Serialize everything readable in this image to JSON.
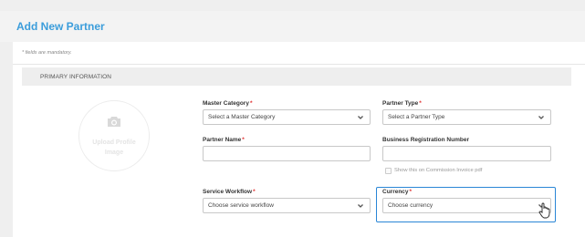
{
  "header": {
    "title": "Add New Partner"
  },
  "form": {
    "mandatory_note": "* fields are mandatory.",
    "section_title": "PRIMARY INFORMATION",
    "upload_label": "Upload Profile Image",
    "required_mark": "*",
    "master_category": {
      "label": "Master Category",
      "value": "Select a Master Category"
    },
    "partner_type": {
      "label": "Partner Type",
      "value": "Select a Partner Type"
    },
    "partner_name": {
      "label": "Partner Name",
      "value": ""
    },
    "business_reg": {
      "label": "Business Registration Number",
      "value": ""
    },
    "show_on_invoice": {
      "label": "Show this on Commission Invoice pdf",
      "checked": false
    },
    "service_workflow": {
      "label": "Service Workflow",
      "value": "Choose service workflow"
    },
    "currency": {
      "label": "Currency",
      "value": "Choose currency"
    }
  },
  "colors": {
    "accent": "#3b9ddb",
    "highlight": "#2a86d6",
    "required": "#e03030"
  },
  "icons": {
    "camera": "camera-icon",
    "dropdown": "chevron-down-icon",
    "cursor": "hand-pointer-icon"
  }
}
